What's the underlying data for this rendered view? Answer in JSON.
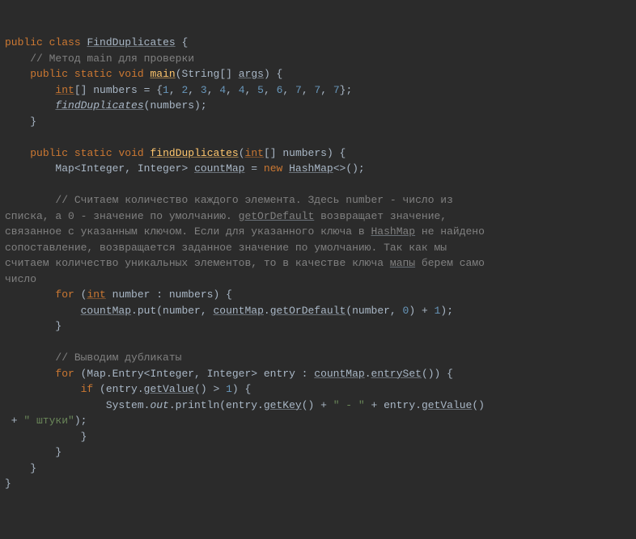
{
  "code": {
    "l1": {
      "public": "public",
      "class": "class",
      "className": "FindDuplicates",
      "brace": " {"
    },
    "l2": {
      "comment": "// Метод main для проверки"
    },
    "l3": {
      "public": "public",
      "static": "static",
      "void": "void",
      "main": "main",
      "open": "(String[] ",
      "args": "args",
      "close": ") {"
    },
    "l4": {
      "int": "int",
      "arr": "[] numbers = {",
      "n1": "1",
      "c": ", ",
      "n2": "2",
      "n3": "3",
      "n4a": "4",
      "n4b": "4",
      "n5": "5",
      "n6": "6",
      "n7a": "7",
      "n7b": "7",
      "n7c": "7",
      "end": "};"
    },
    "l5": {
      "call": "findDuplicates",
      "args": "(numbers);"
    },
    "l6": {
      "brace": "}"
    },
    "l8": {
      "public": "public",
      "static": "static",
      "void": "void",
      "method": "findDuplicates",
      "open": "(",
      "int": "int",
      "rest": "[] numbers) {"
    },
    "l9": {
      "map": "Map<Integer, Integer> ",
      "var": "countMap",
      "eq": " = ",
      "new": "new",
      "sp": " ",
      "hashmap": "HashMap",
      "diamond": "<>();"
    },
    "l11": {
      "c1": "// Считаем количество каждого элемента. Здесь number - число из "
    },
    "l12": {
      "c1": "списка, а 0 - значение по умолчанию. ",
      "u1": "getOrDefault",
      "c2": " возвращает значение, "
    },
    "l13": {
      "c1": "связанное с указанным ключом. Если для указанного ключа в ",
      "u1": "HashMap",
      "c2": " не найдено "
    },
    "l14": {
      "c1": "сопоставление, возвращается заданное значение по умолчанию. Так как мы "
    },
    "l15": {
      "c1": "считаем количество уникальных элементов, то в качестве ключа ",
      "u1": "мапы",
      "c2": " берем само "
    },
    "l16": {
      "c1": "число"
    },
    "l17": {
      "for": "for",
      "open": " (",
      "int": "int",
      "rest": " number : numbers) {"
    },
    "l18": {
      "cmap": "countMap",
      "put": ".put(number, ",
      "cmap2": "countMap",
      "dot": ".",
      "god": "getOrDefault",
      "args": "(number, ",
      "zero": "0",
      "end": ") + ",
      "one": "1",
      "semi": ");"
    },
    "l19": {
      "brace": "}"
    },
    "l21": {
      "comment": "// Выводим дубликаты"
    },
    "l22": {
      "for": "for",
      "open": " (Map.Entry<Integer, Integer> entry : ",
      "cmap": "countMap",
      "dot": ".",
      "es": "entrySet",
      "close": "()) {"
    },
    "l23": {
      "if": "if",
      "open": " (entry.",
      "gv": "getValue",
      "cmp": "() > ",
      "one": "1",
      "close": ") {"
    },
    "l24": {
      "sys": "System.",
      "out": "out",
      "pr": ".println(entry.",
      "gk": "getKey",
      "mid": "() + ",
      "dash": "\" - \"",
      "plus": " + entry.",
      "gv": "getValue",
      "end": "()"
    },
    "l25": {
      "str": "\" штуки\"",
      "end": ");",
      "plus": " + "
    },
    "l26": {
      "brace": "}"
    },
    "l27": {
      "brace": "}"
    },
    "l28": {
      "brace": "}"
    },
    "l29": {
      "brace": "}"
    }
  }
}
